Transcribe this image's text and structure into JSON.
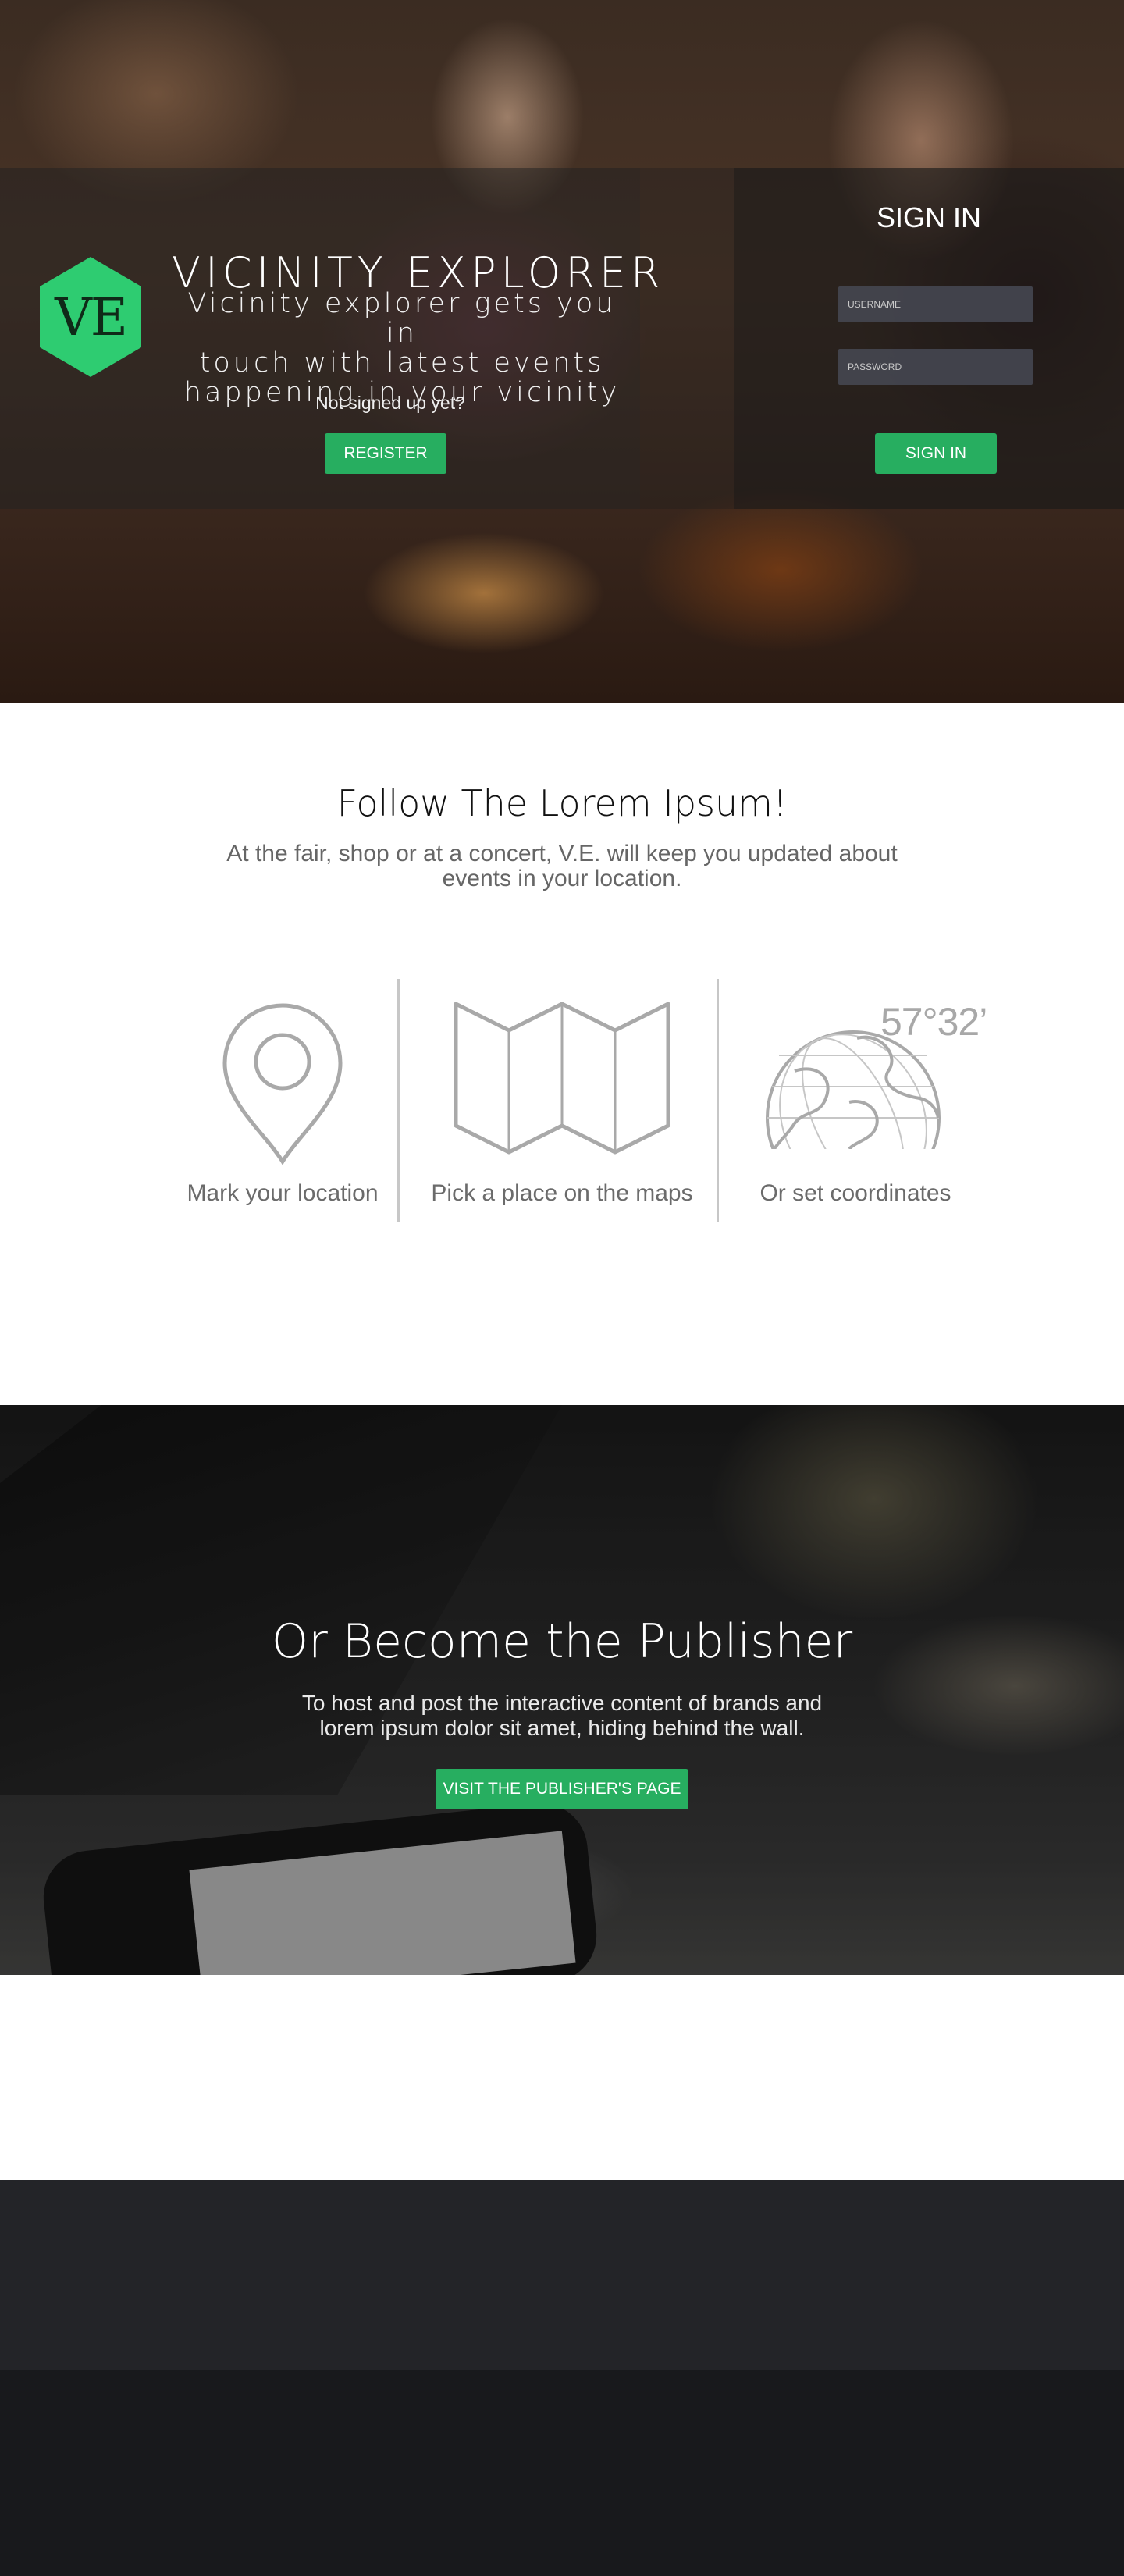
{
  "hero": {
    "logo_text": "VE",
    "title": "VICINITY EXPLORER",
    "tagline_lines": [
      "Vicinity explorer gets you in",
      "touch with latest events",
      "happening in your vicinity"
    ],
    "not_signed_text": "Not signed up yet?",
    "register_label": "REGISTER"
  },
  "signin": {
    "title": "SIGN IN",
    "username_placeholder": "USERNAME",
    "password_placeholder": "PASSWORD",
    "button_label": "SIGN IN"
  },
  "features": {
    "title": "Follow The Lorem Ipsum!",
    "subtitle_lines": [
      "At the fair, shop or at a concert, V.E. will keep you updated about",
      "events in your location."
    ],
    "items": [
      {
        "icon": "location-pin-icon",
        "label": "Mark your location"
      },
      {
        "icon": "folded-map-icon",
        "label": "Pick a place on the maps"
      },
      {
        "icon": "globe-icon",
        "label": "Or set coordinates"
      }
    ],
    "coordinate_readout": "57°32’"
  },
  "publisher": {
    "title": "Or Become the Publisher",
    "subtitle_lines": [
      "To host and post the interactive content of brands and",
      "lorem ipsum dolor sit amet, hiding behind the wall."
    ],
    "button_label": "VISIT THE PUBLISHER'S PAGE"
  },
  "colors": {
    "accent_green": "#27ae60",
    "logo_green": "#2ecc71",
    "footer_top": "#232428",
    "footer_bottom": "#18191c"
  }
}
